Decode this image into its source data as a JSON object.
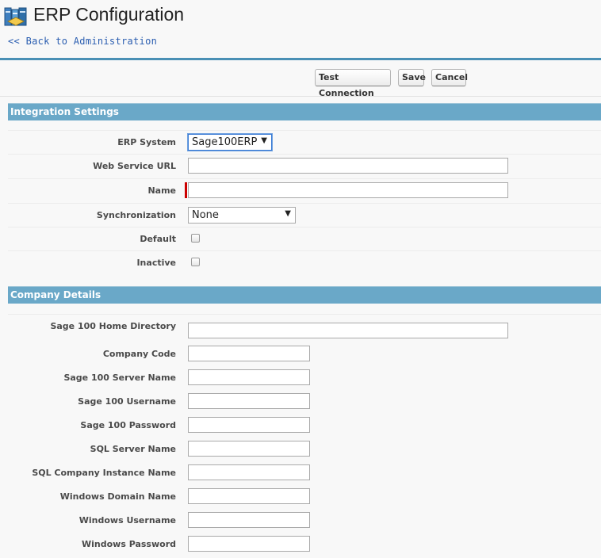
{
  "header": {
    "title": "ERP Configuration",
    "back_link": "<< Back to Administration"
  },
  "toolbar": {
    "test_connection": "Test Connection",
    "save": "Save",
    "cancel": "Cancel"
  },
  "integration": {
    "section_title": "Integration Settings",
    "erp_system": {
      "label": "ERP System",
      "value": "Sage100ERP"
    },
    "web_service_url": {
      "label": "Web Service URL",
      "value": ""
    },
    "name": {
      "label": "Name",
      "value": ""
    },
    "synchronization": {
      "label": "Synchronization",
      "value": "None"
    },
    "default": {
      "label": "Default",
      "checked": false
    },
    "inactive": {
      "label": "Inactive",
      "checked": false
    }
  },
  "company": {
    "section_title": "Company Details",
    "home_directory": {
      "label": "Sage 100 Home Directory",
      "value": ""
    },
    "company_code": {
      "label": "Company Code",
      "value": ""
    },
    "server_name": {
      "label": "Sage 100 Server Name",
      "value": ""
    },
    "username": {
      "label": "Sage 100 Username",
      "value": ""
    },
    "password": {
      "label": "Sage 100 Password",
      "value": ""
    },
    "sql_server_name": {
      "label": "SQL Server Name",
      "value": ""
    },
    "sql_instance_name": {
      "label": "SQL Company Instance Name",
      "value": ""
    },
    "windows_domain": {
      "label": "Windows Domain Name",
      "value": ""
    },
    "windows_username": {
      "label": "Windows Username",
      "value": ""
    },
    "windows_password": {
      "label": "Windows Password",
      "value": ""
    }
  },
  "colors": {
    "section_bar": "#6aa8c8",
    "header_rule": "#4a90b5",
    "link": "#2a5db0",
    "required": "#cc0000"
  },
  "icons": {
    "header": "erp-books-icon",
    "dropdown": "dropdown-arrow-icon"
  }
}
